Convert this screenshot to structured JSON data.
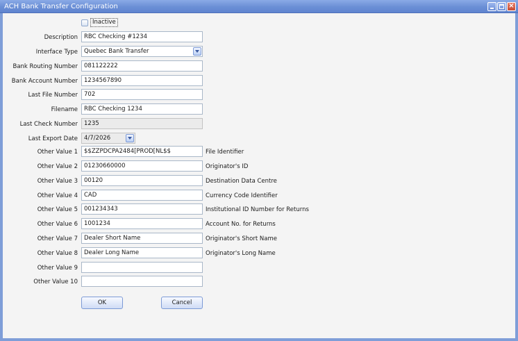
{
  "window": {
    "title": "ACH Bank Transfer Configuration"
  },
  "inactive": {
    "label": "Inactive",
    "checked": false
  },
  "fields": {
    "description": {
      "label": "Description",
      "value": "RBC Checking #1234"
    },
    "interface_type": {
      "label": "Interface Type",
      "value": "Quebec Bank Transfer"
    },
    "routing": {
      "label": "Bank Routing Number",
      "value": "081122222"
    },
    "account": {
      "label": "Bank Account Number",
      "value": "1234567890"
    },
    "last_file": {
      "label": "Last File Number",
      "value": "702"
    },
    "filename": {
      "label": "Filename",
      "value": "RBC Checking 1234"
    },
    "last_check": {
      "label": "Last Check Number",
      "value": "1235"
    },
    "last_export": {
      "label": "Last Export Date",
      "value": "4/7/2026"
    }
  },
  "other_values": [
    {
      "label": "Other Value 1",
      "value": "$$ZZPDCPA2484[PROD[NL$$",
      "desc": "File Identifier"
    },
    {
      "label": "Other Value 2",
      "value": "01230660000",
      "desc": "Originator's ID"
    },
    {
      "label": "Other Value 3",
      "value": "00120",
      "desc": "Destination Data Centre"
    },
    {
      "label": "Other Value 4",
      "value": "CAD",
      "desc": "Currency Code Identifier"
    },
    {
      "label": "Other Value 5",
      "value": "001234343",
      "desc": "Institutional ID Number for Returns"
    },
    {
      "label": "Other Value 6",
      "value": "1001234",
      "desc": "Account No. for Returns"
    },
    {
      "label": "Other Value 7",
      "value": "Dealer Short Name",
      "desc": "Originator's Short Name"
    },
    {
      "label": "Other Value 8",
      "value": "Dealer Long Name",
      "desc": "Originator's Long Name"
    },
    {
      "label": "Other Value 9",
      "value": "",
      "desc": ""
    },
    {
      "label": "Other Value 10",
      "value": "",
      "desc": ""
    }
  ],
  "buttons": {
    "ok": "OK",
    "cancel": "Cancel"
  },
  "colors": {
    "titlebar": "#6b8fd6",
    "window_border": "#7f9ed8",
    "background": "#f4f4f4"
  }
}
